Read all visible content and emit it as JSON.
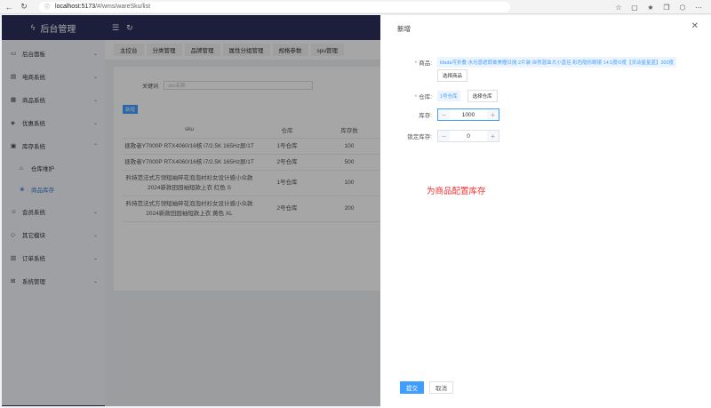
{
  "browser": {
    "url_host": "localhost:5173",
    "url_path": "/#/wms/wareSku/list"
  },
  "app": {
    "title": "后台管理"
  },
  "sidebar": {
    "items": [
      {
        "label": "后台面板",
        "icon": "dashboard-icon"
      },
      {
        "label": "电商系统",
        "icon": "shop-icon"
      },
      {
        "label": "商品系统",
        "icon": "product-icon"
      },
      {
        "label": "优惠系统",
        "icon": "coupon-icon"
      },
      {
        "label": "库存系统",
        "icon": "warehouse-icon"
      },
      {
        "label": "仓库维护",
        "icon": "home-icon"
      },
      {
        "label": "商品库存",
        "icon": "stock-icon"
      },
      {
        "label": "会员系统",
        "icon": "member-icon"
      },
      {
        "label": "其它模块",
        "icon": "module-icon"
      },
      {
        "label": "订单系统",
        "icon": "order-icon"
      },
      {
        "label": "系统管理",
        "icon": "system-icon"
      }
    ]
  },
  "tabs": [
    "主控台",
    "分类管理",
    "品牌管理",
    "属性分组管理",
    "规格参数",
    "spu管理"
  ],
  "filter": {
    "label": "关键词",
    "placeholder": "sku名称"
  },
  "add_label": "新增",
  "table": {
    "headers": [
      "sku",
      "仓库",
      "库存数"
    ],
    "rows": [
      {
        "sku": "拯救者Y7000P RTX4060/16核 i7/2.5K 165Hz屏/1T",
        "warehouse": "1号仓库",
        "stock": "100"
      },
      {
        "sku": "拯救者Y7000P RTX4060/16核 i7/2.5K 165Hz屏/1T",
        "warehouse": "2号仓库",
        "stock": "500"
      },
      {
        "sku": "矜持范法式方领短袖碎花泡泡衬衫女设计感小众款2024新款田园袖短款上衣 红色 S",
        "warehouse": "1号仓库",
        "stock": "100"
      },
      {
        "sku": "矜持范法式方领短袖碎花泡泡衬衫女设计感小众款2024新款田园袖短款上衣 黄色 XL",
        "warehouse": "2号仓库",
        "stock": "200"
      }
    ]
  },
  "drawer": {
    "title": "新增",
    "product_label": "商品:",
    "product_tag": "kfada可折叠 水光感遮瑕膏美瞳日抛 2片装 自然混血大小直径 彩色隐形眼镜 14.5度/0度【灵动星星蓝】300度",
    "select_product": "选择商品",
    "warehouse_label": "仓库:",
    "warehouse_tag": "1号仓库",
    "select_warehouse": "选择仓库",
    "stock_label": "库存:",
    "stock_value": "1000",
    "locked_label": "锁定库存:",
    "locked_value": "0",
    "submit": "提交",
    "cancel": "取消"
  },
  "annotation": "为商品配置库存",
  "colors": {
    "primary": "#409eff",
    "sidebar": "#2b2e5c",
    "annotation": "#f03030"
  }
}
